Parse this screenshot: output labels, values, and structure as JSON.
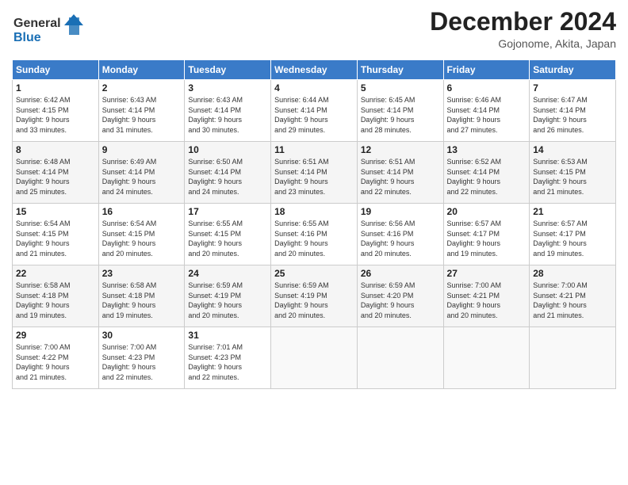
{
  "header": {
    "logo_line1": "General",
    "logo_line2": "Blue",
    "month": "December 2024",
    "location": "Gojonome, Akita, Japan"
  },
  "weekdays": [
    "Sunday",
    "Monday",
    "Tuesday",
    "Wednesday",
    "Thursday",
    "Friday",
    "Saturday"
  ],
  "weeks": [
    [
      {
        "day": "1",
        "info": "Sunrise: 6:42 AM\nSunset: 4:15 PM\nDaylight: 9 hours\nand 33 minutes."
      },
      {
        "day": "2",
        "info": "Sunrise: 6:43 AM\nSunset: 4:14 PM\nDaylight: 9 hours\nand 31 minutes."
      },
      {
        "day": "3",
        "info": "Sunrise: 6:43 AM\nSunset: 4:14 PM\nDaylight: 9 hours\nand 30 minutes."
      },
      {
        "day": "4",
        "info": "Sunrise: 6:44 AM\nSunset: 4:14 PM\nDaylight: 9 hours\nand 29 minutes."
      },
      {
        "day": "5",
        "info": "Sunrise: 6:45 AM\nSunset: 4:14 PM\nDaylight: 9 hours\nand 28 minutes."
      },
      {
        "day": "6",
        "info": "Sunrise: 6:46 AM\nSunset: 4:14 PM\nDaylight: 9 hours\nand 27 minutes."
      },
      {
        "day": "7",
        "info": "Sunrise: 6:47 AM\nSunset: 4:14 PM\nDaylight: 9 hours\nand 26 minutes."
      }
    ],
    [
      {
        "day": "8",
        "info": "Sunrise: 6:48 AM\nSunset: 4:14 PM\nDaylight: 9 hours\nand 25 minutes."
      },
      {
        "day": "9",
        "info": "Sunrise: 6:49 AM\nSunset: 4:14 PM\nDaylight: 9 hours\nand 24 minutes."
      },
      {
        "day": "10",
        "info": "Sunrise: 6:50 AM\nSunset: 4:14 PM\nDaylight: 9 hours\nand 24 minutes."
      },
      {
        "day": "11",
        "info": "Sunrise: 6:51 AM\nSunset: 4:14 PM\nDaylight: 9 hours\nand 23 minutes."
      },
      {
        "day": "12",
        "info": "Sunrise: 6:51 AM\nSunset: 4:14 PM\nDaylight: 9 hours\nand 22 minutes."
      },
      {
        "day": "13",
        "info": "Sunrise: 6:52 AM\nSunset: 4:14 PM\nDaylight: 9 hours\nand 22 minutes."
      },
      {
        "day": "14",
        "info": "Sunrise: 6:53 AM\nSunset: 4:15 PM\nDaylight: 9 hours\nand 21 minutes."
      }
    ],
    [
      {
        "day": "15",
        "info": "Sunrise: 6:54 AM\nSunset: 4:15 PM\nDaylight: 9 hours\nand 21 minutes."
      },
      {
        "day": "16",
        "info": "Sunrise: 6:54 AM\nSunset: 4:15 PM\nDaylight: 9 hours\nand 20 minutes."
      },
      {
        "day": "17",
        "info": "Sunrise: 6:55 AM\nSunset: 4:15 PM\nDaylight: 9 hours\nand 20 minutes."
      },
      {
        "day": "18",
        "info": "Sunrise: 6:55 AM\nSunset: 4:16 PM\nDaylight: 9 hours\nand 20 minutes."
      },
      {
        "day": "19",
        "info": "Sunrise: 6:56 AM\nSunset: 4:16 PM\nDaylight: 9 hours\nand 20 minutes."
      },
      {
        "day": "20",
        "info": "Sunrise: 6:57 AM\nSunset: 4:17 PM\nDaylight: 9 hours\nand 19 minutes."
      },
      {
        "day": "21",
        "info": "Sunrise: 6:57 AM\nSunset: 4:17 PM\nDaylight: 9 hours\nand 19 minutes."
      }
    ],
    [
      {
        "day": "22",
        "info": "Sunrise: 6:58 AM\nSunset: 4:18 PM\nDaylight: 9 hours\nand 19 minutes."
      },
      {
        "day": "23",
        "info": "Sunrise: 6:58 AM\nSunset: 4:18 PM\nDaylight: 9 hours\nand 19 minutes."
      },
      {
        "day": "24",
        "info": "Sunrise: 6:59 AM\nSunset: 4:19 PM\nDaylight: 9 hours\nand 20 minutes."
      },
      {
        "day": "25",
        "info": "Sunrise: 6:59 AM\nSunset: 4:19 PM\nDaylight: 9 hours\nand 20 minutes."
      },
      {
        "day": "26",
        "info": "Sunrise: 6:59 AM\nSunset: 4:20 PM\nDaylight: 9 hours\nand 20 minutes."
      },
      {
        "day": "27",
        "info": "Sunrise: 7:00 AM\nSunset: 4:21 PM\nDaylight: 9 hours\nand 20 minutes."
      },
      {
        "day": "28",
        "info": "Sunrise: 7:00 AM\nSunset: 4:21 PM\nDaylight: 9 hours\nand 21 minutes."
      }
    ],
    [
      {
        "day": "29",
        "info": "Sunrise: 7:00 AM\nSunset: 4:22 PM\nDaylight: 9 hours\nand 21 minutes."
      },
      {
        "day": "30",
        "info": "Sunrise: 7:00 AM\nSunset: 4:23 PM\nDaylight: 9 hours\nand 22 minutes."
      },
      {
        "day": "31",
        "info": "Sunrise: 7:01 AM\nSunset: 4:23 PM\nDaylight: 9 hours\nand 22 minutes."
      },
      {
        "day": "",
        "info": ""
      },
      {
        "day": "",
        "info": ""
      },
      {
        "day": "",
        "info": ""
      },
      {
        "day": "",
        "info": ""
      }
    ]
  ]
}
